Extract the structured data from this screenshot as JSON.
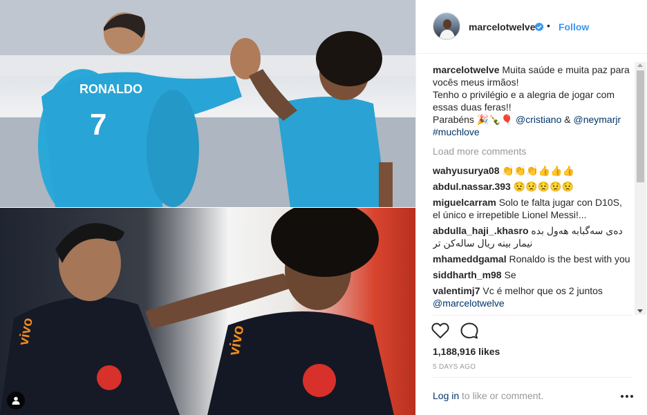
{
  "post": {
    "username": "marcelotwelve",
    "follow_label": "Follow",
    "separator": "•",
    "caption": {
      "username": "marcelotwelve",
      "line1": "Muita saúde e muita paz para vocês meus irmãos!",
      "line2": "Tenho o privilégio e a alegria de jogar com essas duas feras!!",
      "line3_prefix": "Parabéns 🎉🍾🎈",
      "mention1": "@cristiano",
      "amp": "&",
      "mention2": "@neymarjr",
      "hashtag": "#muchlove"
    },
    "load_more": "Load more comments",
    "comments": [
      {
        "user": "wahyusurya08",
        "text": "👏👏👏👍👍👍"
      },
      {
        "user": "abdul.nassar.393",
        "text": "😟😟😟😟😟"
      },
      {
        "user": "miguelcarram",
        "text": "Solo te falta jugar con D10S, el único e irrepetible Lionel Messi!..."
      },
      {
        "user": "abdulla_haji_.khasro",
        "text": "دەی سەگبابە هەول بدە نیمار بینە ریال سالەکن تر"
      },
      {
        "user": "mhameddgamal",
        "text": "Ronaldo is the best with you"
      },
      {
        "user": "siddharth_m98",
        "text": "Se"
      },
      {
        "user": "valentimj7",
        "text": "Vc é melhor que os 2 juntos"
      },
      {
        "user": "",
        "text": "@marcelotwelve"
      }
    ],
    "likes": "1,188,916 likes",
    "time_ago": "5 DAYS AGO",
    "login_link": "Log in",
    "login_suffix": "to like or comment.",
    "photo_jersey_text": "RONALDO",
    "icons": {
      "verified": "verified-badge-icon",
      "heart": "heart-icon",
      "comment": "comment-icon",
      "more": "more-options-icon",
      "user_tag": "user-tag-icon"
    },
    "colors": {
      "link": "#3897f0",
      "mention": "#003569",
      "muted": "#999999",
      "verified": "#3897f0"
    }
  }
}
